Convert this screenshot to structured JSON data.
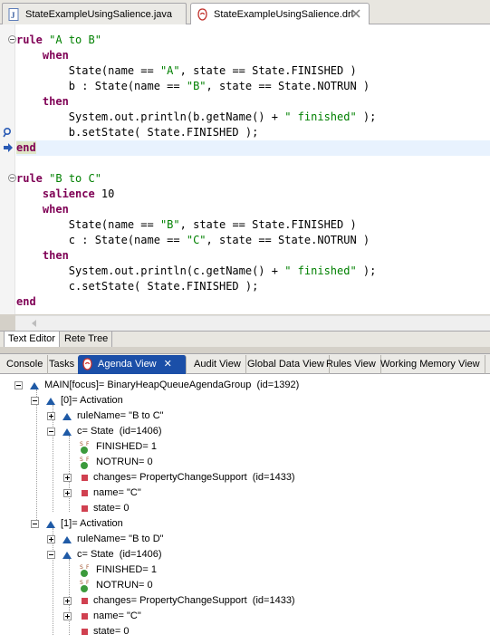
{
  "editor_tabs": [
    {
      "label": "StateExampleUsingSalience.java"
    },
    {
      "label": "StateExampleUsingSalience.drl"
    }
  ],
  "code": {
    "l1_kw": "rule",
    "l1_str": "\"A to B\"",
    "l2_kw": "when",
    "l3a": "State(name == ",
    "l3b": "\"A\"",
    "l3c": ", state == State.FINISHED )",
    "l4a": "b : State(name == ",
    "l4b": "\"B\"",
    "l4c": ", state == State.NOTRUN )",
    "l5_kw": "then",
    "l6a": "System.out.println(b.getName() + ",
    "l6b": "\" finished\"",
    "l6c": " );",
    "l7": "b.setState( State.FINISHED );",
    "l8_kw": "end",
    "l10_kw": "rule",
    "l10_str": "\"B to C\"",
    "l11_kw": "salience",
    "l11_val": " 10",
    "l12_kw": "when",
    "l13a": "State(name == ",
    "l13b": "\"B\"",
    "l13c": ", state == State.FINISHED )",
    "l14a": "c : State(name == ",
    "l14b": "\"C\"",
    "l14c": ", state == State.NOTRUN )",
    "l15_kw": "then",
    "l16a": "System.out.println(c.getName() + ",
    "l16b": "\" finished\"",
    "l16c": " );",
    "l17": "c.setState( State.FINISHED );",
    "l18_kw": "end"
  },
  "sub_tabs": [
    "Text Editor",
    "Rete Tree"
  ],
  "view_tabs": [
    "Console",
    "Tasks",
    "Agenda View",
    "Audit View",
    "Global Data View",
    "Rules View",
    "Working Memory View"
  ],
  "view_close": "✕",
  "tree": {
    "root": "MAIN[focus]= BinaryHeapQueueAgendaGroup  (id=1392)",
    "act0": "[0]= Activation",
    "act0_rule": "ruleName= \"B to C\"",
    "act0_c": "c= State  (id=1406)",
    "finished": "FINISHED= 1",
    "notrun": "NOTRUN= 0",
    "changes": "changes= PropertyChangeSupport  (id=1433)",
    "name": "name= \"C\"",
    "state": "state= 0",
    "act1": "[1]= Activation",
    "act1_rule": "ruleName= \"B to D\"",
    "act1_c": "c= State  (id=1406)"
  },
  "colors": {
    "keyword": "#7f0055",
    "string": "#2a00ff",
    "active_tab": "#1b4fa8"
  }
}
